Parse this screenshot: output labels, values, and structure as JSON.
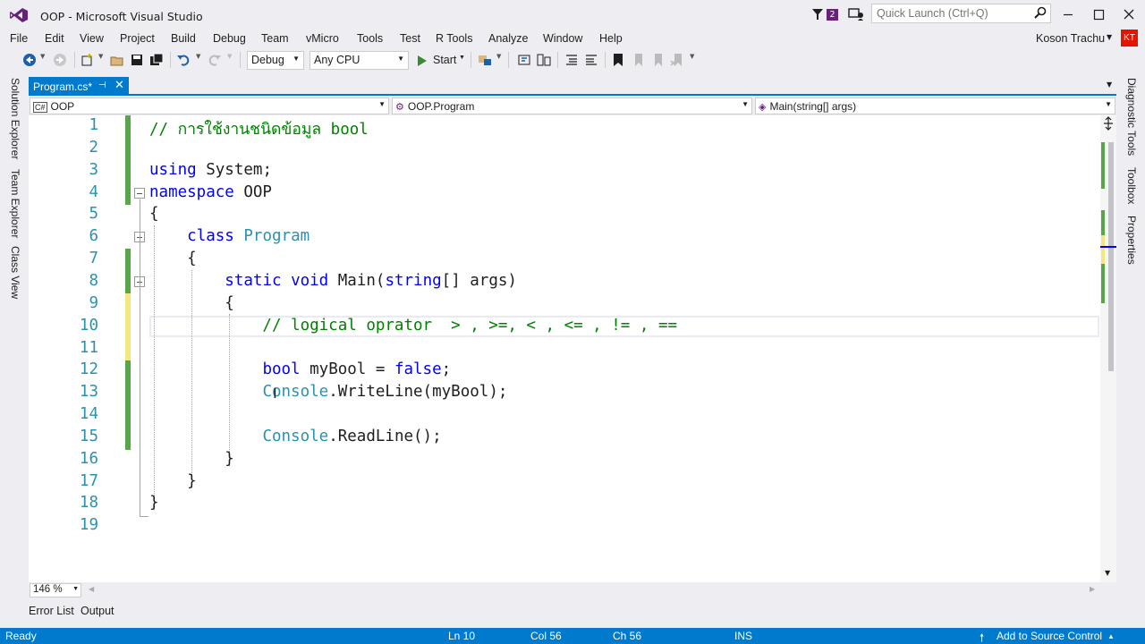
{
  "window": {
    "title": "OOP - Microsoft Visual Studio",
    "notification_count": "2"
  },
  "quick_launch": {
    "placeholder": "Quick Launch (Ctrl+Q)"
  },
  "menu": [
    "File",
    "Edit",
    "View",
    "Project",
    "Build",
    "Debug",
    "Team",
    "vMicro",
    "Tools",
    "Test",
    "R Tools",
    "Analyze",
    "Window",
    "Help"
  ],
  "user": {
    "name": "Koson Trachu",
    "initials": "KT"
  },
  "toolbar": {
    "config": "Debug",
    "platform": "Any CPU",
    "start_label": "Start"
  },
  "left_tool_tabs": [
    "Solution Explorer",
    "Team Explorer",
    "Class View"
  ],
  "right_tool_tabs": [
    "Diagnostic Tools",
    "Toolbox",
    "Properties"
  ],
  "document": {
    "tab_label": "Program.cs*"
  },
  "nav": {
    "project": "OOP",
    "class": "OOP.Program",
    "member": "Main(string[] args)"
  },
  "code_lines": [
    "// การใช้งานชนิดข้อมูล bool",
    "",
    "using System;",
    "namespace OOP",
    "{",
    "    class Program",
    "    {",
    "        static void Main(string[] args)",
    "        {",
    "            // logical oprator  > , >=, < , <= , != , ==",
    "",
    "            bool myBool = false;",
    "            Console.WriteLine(myBool);",
    "",
    "            Console.ReadLine();",
    "        }",
    "    }",
    "}",
    ""
  ],
  "zoom": "146 %",
  "bottom_tabs": [
    "Error List",
    "Output"
  ],
  "status": {
    "state": "Ready",
    "ln": "Ln 10",
    "col": "Col 56",
    "ch": "Ch 56",
    "mode": "INS",
    "source_control": "Add to Source Control"
  },
  "colors": {
    "accent": "#007acc",
    "keyword": "#0000ff",
    "type": "#2b91af",
    "comment": "#008000",
    "changed_saved": "#57a64a",
    "changed_unsaved": "#f3e87f",
    "vs_purple": "#68217a"
  }
}
